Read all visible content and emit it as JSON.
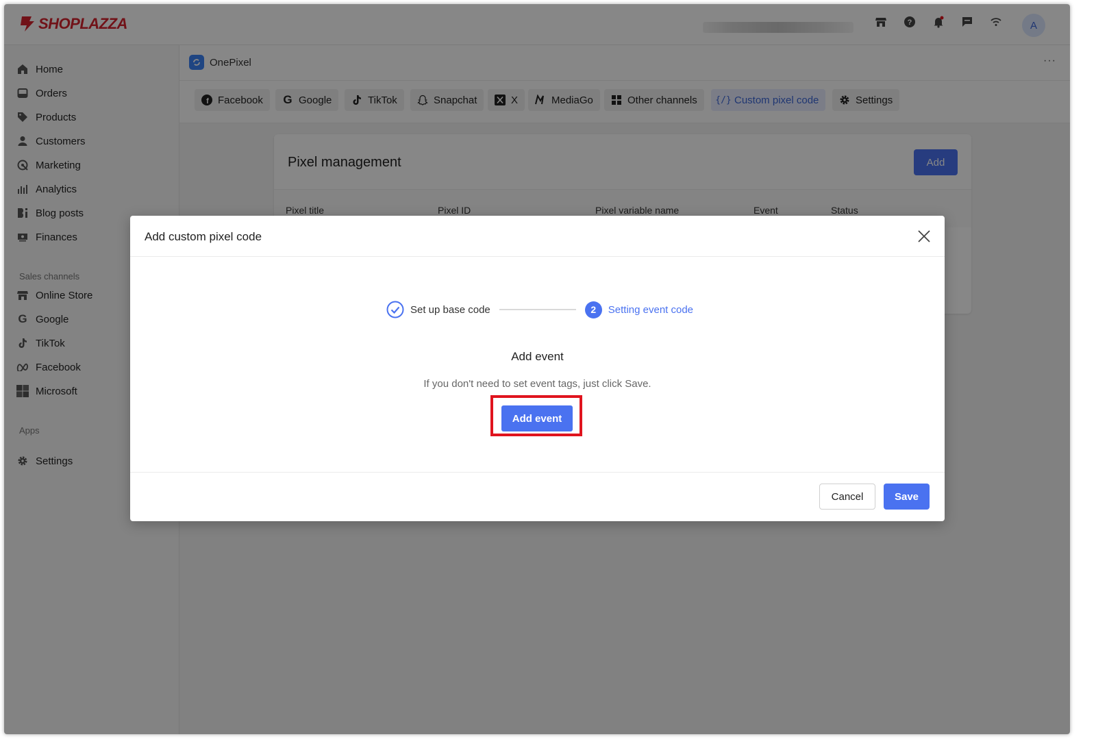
{
  "brand": {
    "name": "SHOPLAZZA",
    "color": "#d5232f"
  },
  "topbar": {
    "icons": [
      "store-icon",
      "help-icon",
      "bell-icon",
      "chat-icon",
      "wifi-icon"
    ],
    "avatar_initial": "A"
  },
  "sidebar": {
    "items": [
      {
        "label": "Home",
        "icon": "home-icon"
      },
      {
        "label": "Orders",
        "icon": "orders-icon"
      },
      {
        "label": "Products",
        "icon": "tag-icon"
      },
      {
        "label": "Customers",
        "icon": "person-icon"
      },
      {
        "label": "Marketing",
        "icon": "marketing-icon"
      },
      {
        "label": "Analytics",
        "icon": "bar-chart-icon"
      },
      {
        "label": "Blog posts",
        "icon": "blog-icon"
      },
      {
        "label": "Finances",
        "icon": "finances-icon"
      }
    ],
    "sales_channels_heading": "Sales channels",
    "channels": [
      {
        "label": "Online Store",
        "icon": "store-icon"
      },
      {
        "label": "Google",
        "icon": "google-icon"
      },
      {
        "label": "TikTok",
        "icon": "tiktok-icon"
      },
      {
        "label": "Facebook",
        "icon": "meta-icon"
      },
      {
        "label": "Microsoft",
        "icon": "microsoft-icon"
      }
    ],
    "apps_heading": "Apps",
    "settings_label": "Settings"
  },
  "app": {
    "title": "OnePixel",
    "more": "···"
  },
  "tabs": [
    {
      "label": "Facebook",
      "icon": "facebook-icon"
    },
    {
      "label": "Google",
      "icon": "google-icon"
    },
    {
      "label": "TikTok",
      "icon": "tiktok-icon"
    },
    {
      "label": "Snapchat",
      "icon": "snapchat-icon"
    },
    {
      "label": "X",
      "icon": "x-icon"
    },
    {
      "label": "MediaGo",
      "icon": "mediago-icon"
    },
    {
      "label": "Other channels",
      "icon": "grid-icon"
    },
    {
      "label": "Custom pixel code",
      "icon": "code-icon",
      "active": true
    },
    {
      "label": "Settings",
      "icon": "gear-icon"
    }
  ],
  "pixel_management": {
    "title": "Pixel management",
    "add_label": "Add",
    "columns": [
      "Pixel title",
      "Pixel ID",
      "Pixel variable name",
      "Event",
      "Status"
    ]
  },
  "modal": {
    "title": "Add custom pixel code",
    "steps": [
      {
        "label": "Set up base code",
        "state": "done"
      },
      {
        "number": "2",
        "label": "Setting event code",
        "state": "current"
      }
    ],
    "section_title": "Add event",
    "hint": "If you don't need to set event tags, just click Save.",
    "add_event_label": "Add event",
    "cancel_label": "Cancel",
    "save_label": "Save"
  },
  "colors": {
    "primary": "#4a72f0",
    "highlight_border": "#e0141e"
  }
}
